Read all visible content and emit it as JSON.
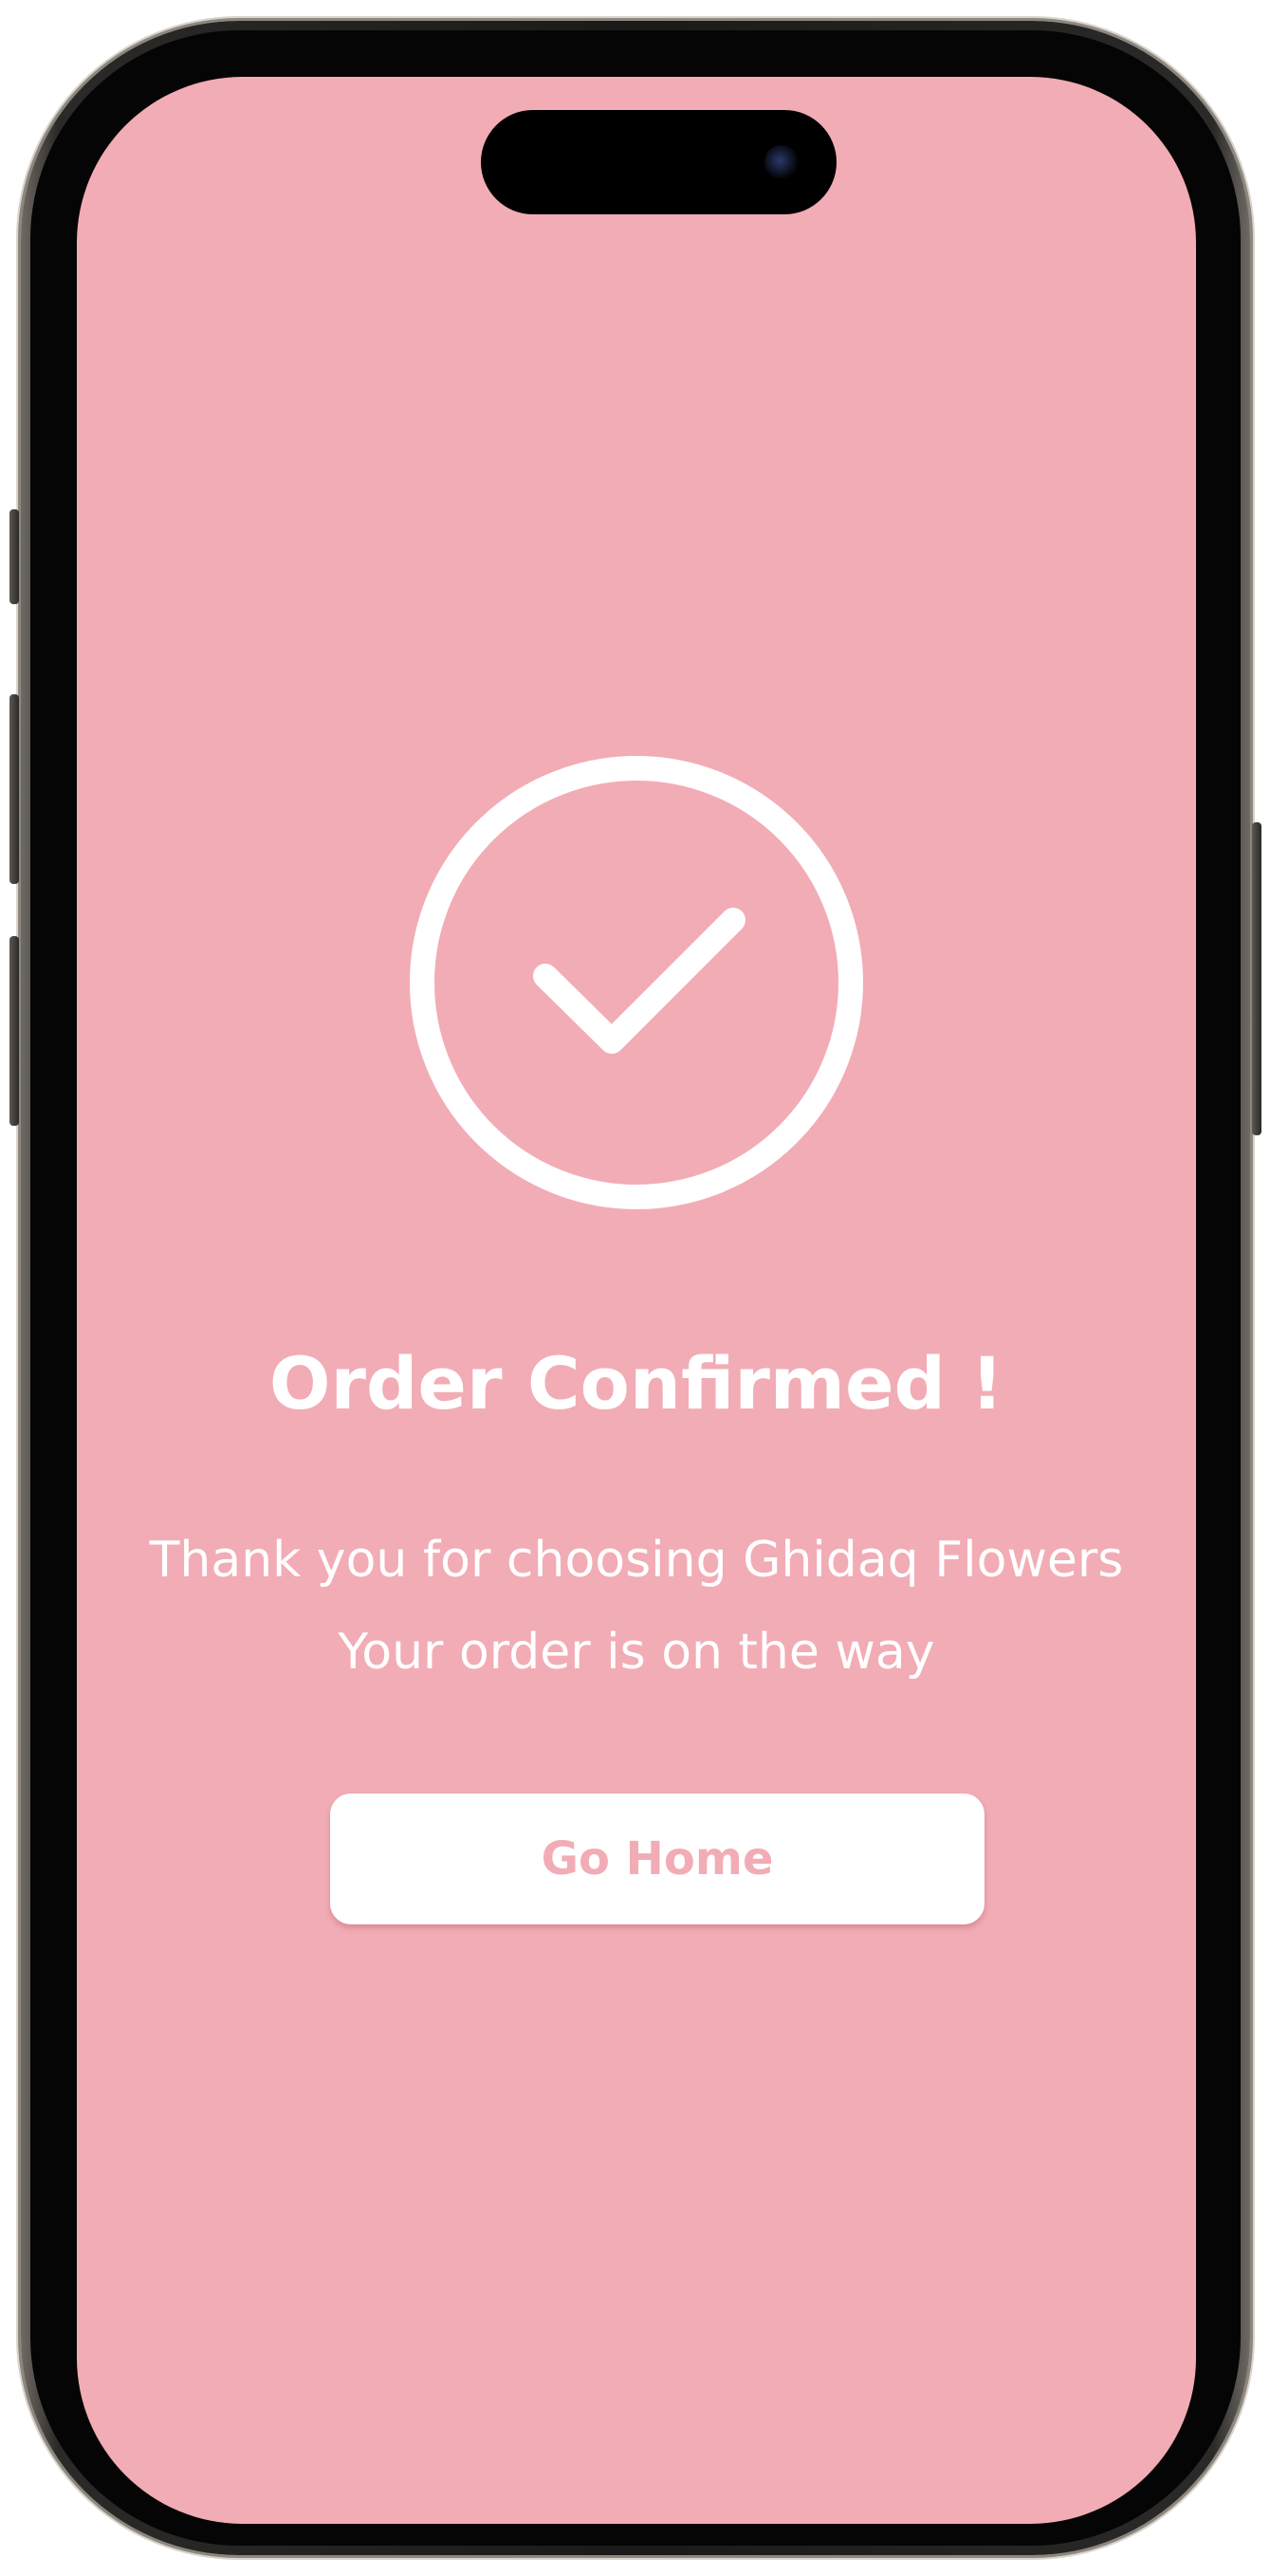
{
  "screen": {
    "background": "#f2acb5",
    "accent": "#ffffff"
  },
  "confirmation": {
    "icon": "check-circle-icon",
    "title": "Order Confirmed !",
    "message_line1": "Thank you for choosing Ghidaq Flowers",
    "message_line2": "Your order is on the way"
  },
  "actions": {
    "go_home_label": "Go Home",
    "button_text_color": "#f2acb5"
  }
}
